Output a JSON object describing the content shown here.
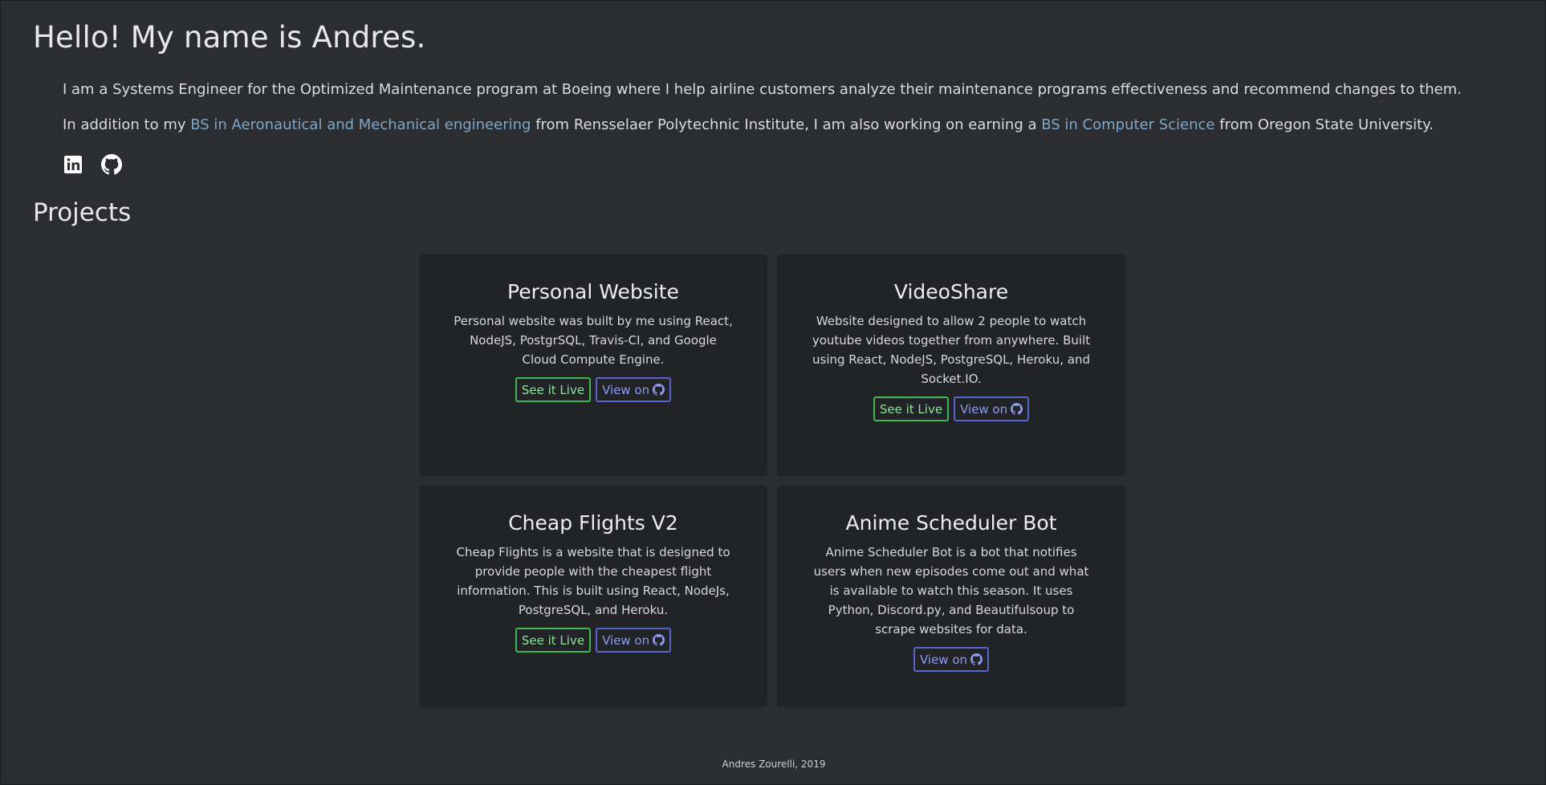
{
  "header": {
    "title": "Hello! My name is Andres."
  },
  "intro": {
    "line1": "I am a Systems Engineer for the Optimized Maintenance program at Boeing where I help airline customers analyze their maintenance programs effectiveness and recommend changes to them.",
    "line2_prefix": "In addition to my ",
    "degree1_link": "BS in Aeronautical and Mechanical engineering",
    "line2_middle": " from Rensselaer Polytechnic Institute, I am also working on earning a ",
    "degree2_link": "BS in Computer Science",
    "line2_suffix": " from Oregon State University."
  },
  "social": {
    "icons": [
      "linkedin-icon",
      "github-icon"
    ]
  },
  "projects": {
    "title": "Projects",
    "live_label": "See it Live",
    "github_label": "View on",
    "items": [
      {
        "title": "Personal Website",
        "description": "Personal website was built by me using React, NodeJS, PostgrSQL, Travis-CI, and Google Cloud Compute Engine."
      },
      {
        "title": "VideoShare",
        "description": "Website designed to allow 2 people to watch youtube videos together from anywhere. Built using React, NodeJS, PostgreSQL, Heroku, and Socket.IO."
      },
      {
        "title": "Cheap Flights V2",
        "description": "Cheap Flights is a website that is designed to provide people with the cheapest flight information. This is built using React, NodeJs, PostgreSQL, and Heroku."
      },
      {
        "title": "Anime Scheduler Bot",
        "description": "Anime Scheduler Bot is a bot that notifies users when new episodes come out and what is available to watch this season. It uses Python, Discord.py, and Beautifulsoup to scrape websites for data."
      }
    ]
  },
  "footer": {
    "text": "Andres Zourelli, 2019"
  },
  "colors": {
    "background": "#2b2d31",
    "card": "#222327",
    "link": "#7ea7c9",
    "live_button": "#3fb950",
    "github_button": "#5566d0"
  }
}
